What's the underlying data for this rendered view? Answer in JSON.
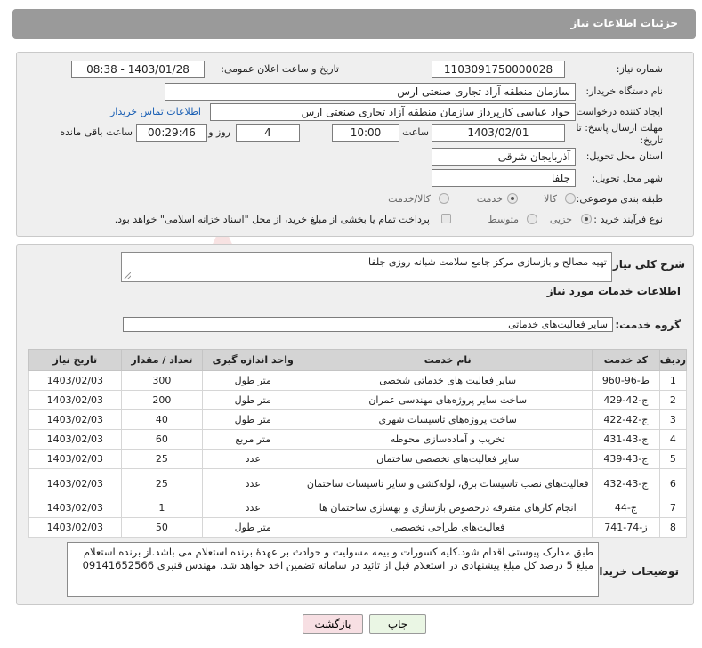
{
  "header": {
    "title": "جزئیات اطلاعات نیاز"
  },
  "need_info": {
    "need_number_label": "شماره نیاز:",
    "need_number": "1103091750000028",
    "announce_label": "تاریخ و ساعت اعلان عمومی:",
    "announce_value": "1403/01/28 - 08:38",
    "buyer_org_label": "نام دستگاه خریدار:",
    "buyer_org": "سازمان منطقه آزاد تجاری صنعتی ارس",
    "requester_label": "ایجاد کننده درخواست:",
    "requester": "جواد عباسی کارپرداز سازمان منطقه آزاد تجاری صنعتی ارس",
    "contact_link": "اطلاعات تماس خریدار",
    "deadline_label_1": "مهلت ارسال پاسخ: تا",
    "deadline_label_2": "تاریخ:",
    "deadline_date": "1403/02/01",
    "time_label": "ساعت",
    "deadline_time": "10:00",
    "days_value": "4",
    "days_label": "روز و",
    "remaining_time": "00:29:46",
    "remaining_label": "ساعت باقی مانده",
    "province_label": "استان محل تحویل:",
    "province": "آذربایجان شرقی",
    "city_label": "شهر محل تحویل:",
    "city": "جلفا",
    "category_label": "طبقه بندی موضوعی:",
    "category_options": [
      "کالا",
      "خدمت",
      "کالا/خدمت"
    ],
    "category_selected": "خدمت",
    "process_label": "نوع فرآیند خرید :",
    "process_options": [
      "جزیی",
      "متوسط"
    ],
    "process_selected": "جزیی",
    "payment_note": "پرداخت تمام یا بخشی از مبلغ خرید، از محل \"اسناد خزانه اسلامی\" خواهد بود."
  },
  "summary": {
    "label": "شرح کلی نیاز:",
    "text": "تهیه مصالح و بازسازی مرکز جامع سلامت شبانه روزی جلفا"
  },
  "services": {
    "section_title": "اطلاعات خدمات مورد نیاز",
    "group_label": "گروه خدمت:",
    "group_value": "سایر فعالیت‌های خدماتی",
    "columns": [
      "ردیف",
      "کد خدمت",
      "نام خدمت",
      "واحد اندازه گیری",
      "تعداد / مقدار",
      "تاریخ نیاز"
    ],
    "rows": [
      {
        "row": "1",
        "code": "ط-96-960",
        "name": "سایر فعالیت های خدماتی شخصی",
        "unit": "متر طول",
        "qty": "300",
        "date": "1403/02/03"
      },
      {
        "row": "2",
        "code": "ج-42-429",
        "name": "ساخت سایر پروژه‌های مهندسی عمران",
        "unit": "متر طول",
        "qty": "200",
        "date": "1403/02/03"
      },
      {
        "row": "3",
        "code": "ج-42-422",
        "name": "ساخت پروژه‌های تاسیسات شهری",
        "unit": "متر طول",
        "qty": "40",
        "date": "1403/02/03"
      },
      {
        "row": "4",
        "code": "ج-43-431",
        "name": "تخریب و آماده‌سازی محوطه",
        "unit": "متر مربع",
        "qty": "60",
        "date": "1403/02/03"
      },
      {
        "row": "5",
        "code": "ج-43-439",
        "name": "سایر فعالیت‌های تخصصی ساختمان",
        "unit": "عدد",
        "qty": "25",
        "date": "1403/02/03"
      },
      {
        "row": "6",
        "code": "ج-43-432",
        "name": "فعالیت‌های نصب تاسیسات برق، لوله‌کشی و سایر تاسیسات ساختمان",
        "unit": "عدد",
        "qty": "25",
        "date": "1403/02/03"
      },
      {
        "row": "7",
        "code": "ج-44",
        "name": "انجام کارهای متفرقه درخصوص بازسازی و بهسازی ساختمان ها",
        "unit": "عدد",
        "qty": "1",
        "date": "1403/02/03"
      },
      {
        "row": "8",
        "code": "ز-74-741",
        "name": "فعالیت‌های طراحی تخصصی",
        "unit": "متر طول",
        "qty": "50",
        "date": "1403/02/03"
      }
    ]
  },
  "buyer_notes": {
    "label": "توضیحات خریدار:",
    "line1": "طبق مدارک پیوستی اقدام شود.کلیه کسورات و بیمه مسولیت و حوادث بر عهدۀ برنده استعلام می باشد.از برنده استعلام",
    "line2": "مبلغ 5 درصد کل مبلغ پیشنهادی در استعلام قبل از تائید در سامانه تضمین اخذ خواهد شد. مهندس قنبری 09141652566"
  },
  "buttons": {
    "print": "چاپ",
    "back": "بازگشت"
  },
  "watermark": {
    "text": "AriaTender.neT"
  }
}
